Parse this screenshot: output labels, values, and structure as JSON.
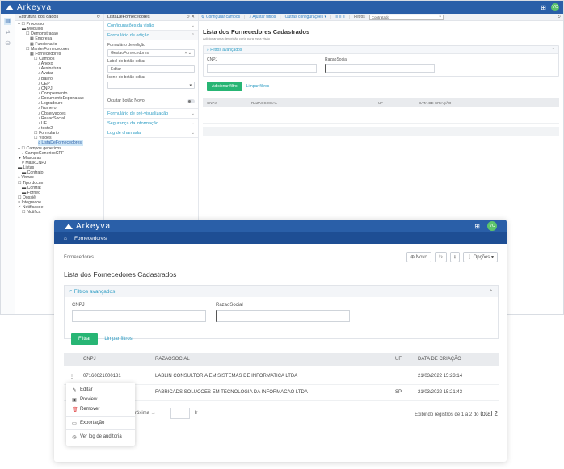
{
  "app": {
    "name": "Arkeyva",
    "avatar": "VC"
  },
  "editor": {
    "tree_title": "Estrutura dos dados",
    "tree": [
      {
        "d": 0,
        "t": "+ ☐ Processo"
      },
      {
        "d": 1,
        "t": "▬ Modulos"
      },
      {
        "d": 2,
        "t": "☐ Demonstracao"
      },
      {
        "d": 3,
        "t": "▦ Empresa"
      },
      {
        "d": 3,
        "t": "▦ Funcionario"
      },
      {
        "d": 2,
        "t": "☐ ManterFornecedores"
      },
      {
        "d": 3,
        "t": "▦ Fornecedores"
      },
      {
        "d": 4,
        "t": "☐ Campos"
      },
      {
        "d": 5,
        "t": "♪ Anexo"
      },
      {
        "d": 5,
        "t": "♪ Assinatura"
      },
      {
        "d": 5,
        "t": "♪ Avatar"
      },
      {
        "d": 5,
        "t": "♪ Bairro"
      },
      {
        "d": 5,
        "t": "♪ CEP"
      },
      {
        "d": 5,
        "t": "♪ CNPJ"
      },
      {
        "d": 5,
        "t": "♪ Complemento"
      },
      {
        "d": 5,
        "t": "♪ DocumentoExportacao"
      },
      {
        "d": 5,
        "t": "♪ Logradouro"
      },
      {
        "d": 5,
        "t": "♪ Numero"
      },
      {
        "d": 5,
        "t": "♪ Observacoes"
      },
      {
        "d": 5,
        "t": "♪ RazaoSocial"
      },
      {
        "d": 5,
        "t": "♪ UF"
      },
      {
        "d": 5,
        "t": "♪ teste2"
      },
      {
        "d": 4,
        "t": "☐ Formulario"
      },
      {
        "d": 4,
        "t": "☐ Visoes"
      },
      {
        "d": 5,
        "t": "⌕ ListaDeFornecedores",
        "sel": true
      },
      {
        "d": 0,
        "t": "+ ☐ Campos genericos"
      },
      {
        "d": 1,
        "t": "♪ CampoGenericoCPF"
      },
      {
        "d": 0,
        "t": "▼ Mascaras"
      },
      {
        "d": 1,
        "t": "# MaskCNPJ"
      },
      {
        "d": 0,
        "t": "▬ Listas"
      },
      {
        "d": 1,
        "t": "▬ Contrato"
      },
      {
        "d": 0,
        "t": "⌕ Visoes"
      },
      {
        "d": 0,
        "t": "☐ Tipo docum"
      },
      {
        "d": 1,
        "t": "▬ Contrat"
      },
      {
        "d": 1,
        "t": "▬ Fornec"
      },
      {
        "d": 0,
        "t": "☐ Dossiê"
      },
      {
        "d": 0,
        "t": "≡ Integracoe"
      },
      {
        "d": 0,
        "t": "✓ Notificacoe"
      },
      {
        "d": 1,
        "t": "☐ Notifica"
      }
    ],
    "mid_title": "ListaDeFornecedores",
    "acc1": "Configurações da visão",
    "acc2": "Formulário de edição",
    "f1_label": "Formulário de edição",
    "f1_value": "GestaoFornecedores",
    "f2_label": "Label do botão editar",
    "f2_value": "Editar",
    "f3_label": "Ícone do botão editar",
    "toggle_label": "Ocultar botão Novo",
    "acc3": "Formulário de pré-visualização",
    "acc4": "Segurança da informação",
    "acc5": "Log de chamada",
    "toolbar": {
      "cfg": "Configurar campos",
      "filt": "Ajustar filtros",
      "more": "Outras configurações",
      "filtros": "Filtros",
      "select": "Contratado"
    },
    "list_title": "Lista dos Fornecedores Cadastrados",
    "list_sub": "Adicionar uma descrição curta para essa visão",
    "adv": "Filtros avançados",
    "f_cnpj": "CNPJ",
    "f_rs": "RazaoSocial",
    "btn_add": "Adicionar filtro",
    "btn_clear": "Limpar filtros",
    "cols": [
      "CNPJ",
      "RAZAOSOCIAL",
      "UF",
      "DATA DE CRIAÇÃO"
    ]
  },
  "preview": {
    "nav": "Fornecedores",
    "breadcrumb": "Fornecedores",
    "btn_new": "Novo",
    "btn_opts": "Opções",
    "title": "Lista dos Fornecedores Cadastrados",
    "adv": "Filtros avançados",
    "f_cnpj": "CNPJ",
    "f_rs": "RazaoSocial",
    "btn_filter": "Filtrar",
    "btn_clear": "Limpar filtros",
    "cols": [
      "CNPJ",
      "RAZAOSOCIAL",
      "UF",
      "DATA DE CRIAÇÃO"
    ],
    "rows": [
      {
        "cnpj": "07160621000181",
        "rs": "LABLIN CONSULTORIA EM SISTEMAS DE INFORMATICA LTDA",
        "uf": "",
        "date": "21/03/2022 15:23:14"
      },
      {
        "cnpj": "",
        "rs": "FABRICADS SOLUCOES EM TECNOLOGIA DA INFORMACAO LTDA",
        "uf": "SP",
        "date": "21/03/2022 15:21:43"
      }
    ],
    "menu": [
      "Editar",
      "Preview",
      "Remover",
      "Exportação",
      "Ver log de auditoria"
    ],
    "next": "Próxima",
    "count_text": "Exibindo registros de 1 a 2 do",
    "count_total": "total 2"
  }
}
